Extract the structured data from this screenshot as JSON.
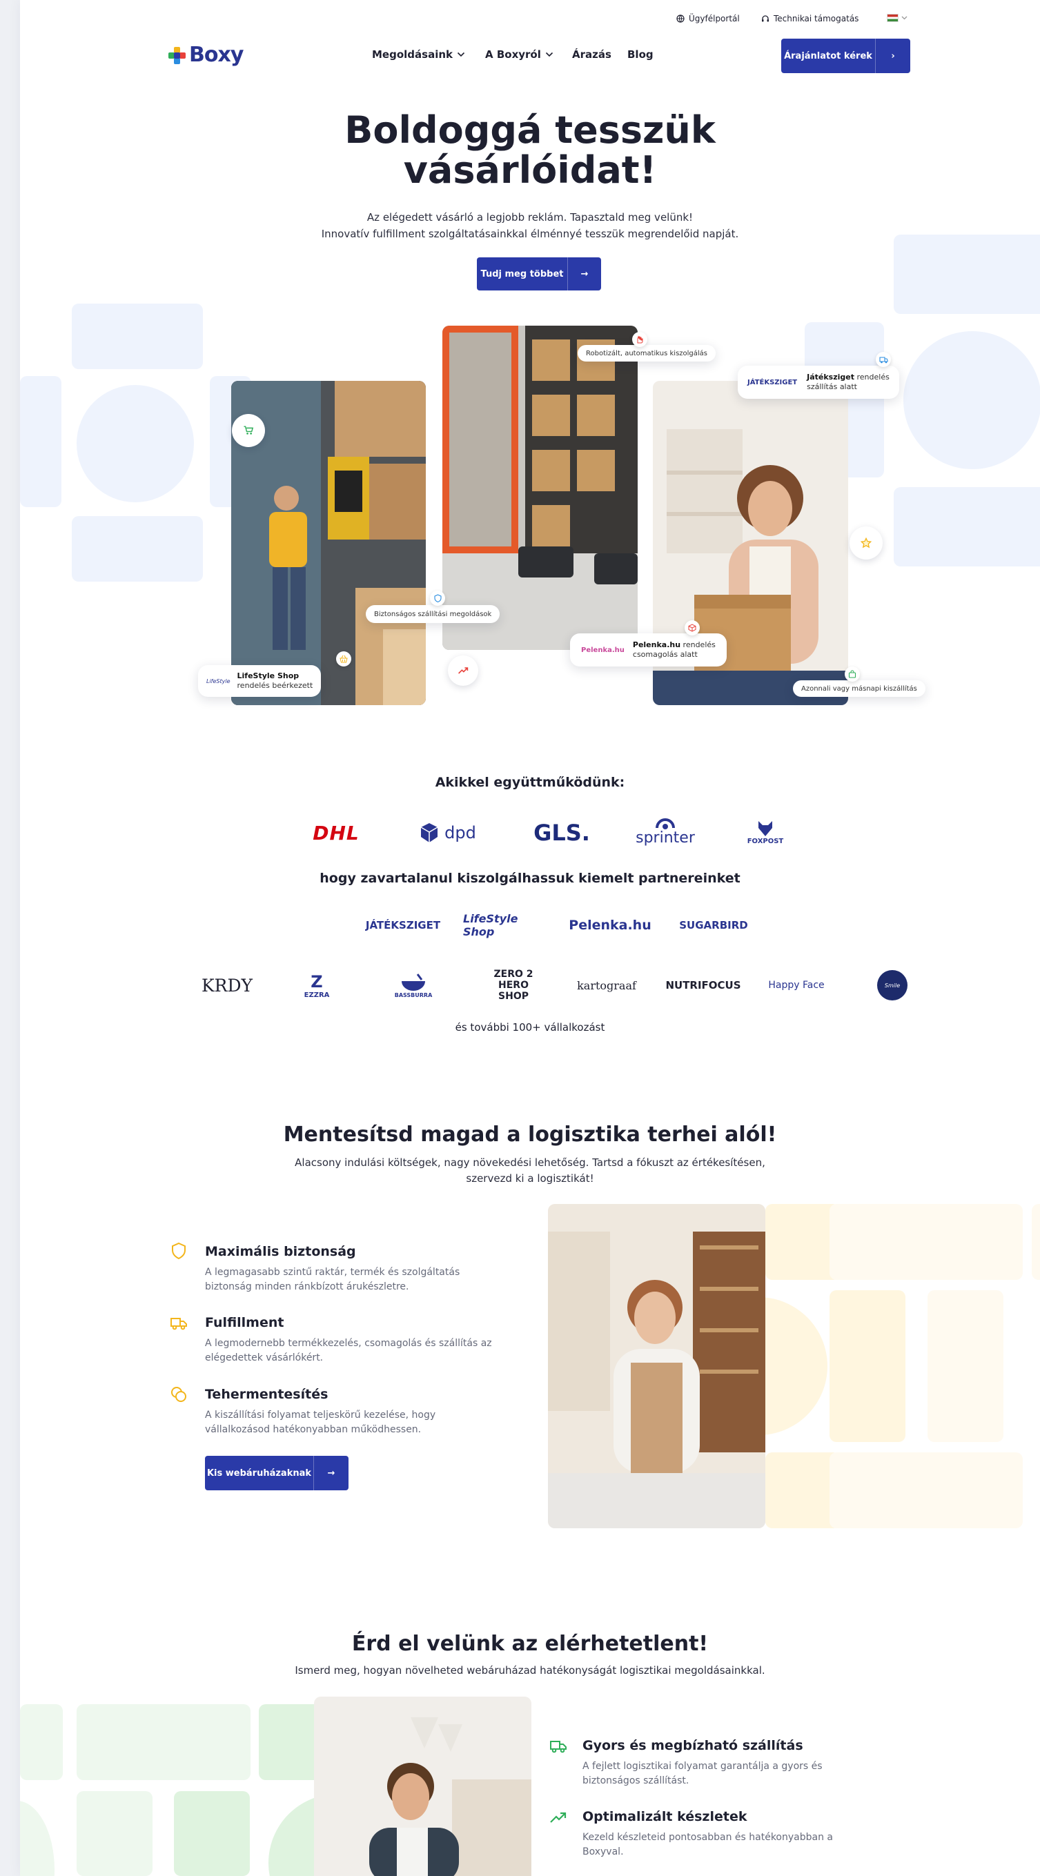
{
  "colors": {
    "navy": "#2a3aa8",
    "brand_text": "#2a3590",
    "yellow": "#f3b51b",
    "green": "#2fae59",
    "pale_blue": "#eef3fd",
    "pale_yellow": "#fff6df",
    "pale_green": "#eef8ee"
  },
  "topbar": {
    "customer_portal": "Ügyfélportál",
    "tech_support": "Technikai támogatás"
  },
  "header": {
    "logo": "Boxy",
    "nav": [
      "Megoldásaink",
      "A Boxyról",
      "Árazás",
      "Blog"
    ],
    "cta": "Árajánlatot kérek",
    "cta_arrow": "›"
  },
  "hero": {
    "title_line1": "Boldoggá tesszük",
    "title_line2": "vásárlóidat!",
    "sub_line1": "Az elégedett vásárló a legjobb reklám. Tapasztald meg velünk!",
    "sub_line2": "Innovatív fulfillment szolgáltatásainkkal élménnyé tesszük megrendelőid napját.",
    "cta": "Tudj meg többet",
    "cta_arrow": "→",
    "chips": {
      "robots": "Robotizált, automatikus kiszolgálás",
      "jateksziget_bold": "Játéksziget",
      "jateksziget_rest1": " rendelés",
      "jateksziget_rest2": "szállítás alatt",
      "safety": "Biztonságos szállítási megoldások",
      "pelenka_bold": "Pelenka.hu",
      "pelenka_rest1": " rendelés",
      "pelenka_rest2": "csomagolás alatt",
      "lifestyle_bold": "LifeStyle Shop",
      "lifestyle_rest": "rendelés beérkezett",
      "sameday": "Azonnali vagy másnapi kiszállítás"
    },
    "icons": [
      "cart-icon",
      "hand-icon",
      "truck-icon",
      "star-icon",
      "shield-icon",
      "box-icon",
      "trend-icon",
      "basket-icon",
      "bag-icon"
    ]
  },
  "partners": {
    "carriers_title": "Akikkel együttműködünk:",
    "carriers": [
      "DHL",
      "dpd",
      "GLS.",
      "sprinter",
      "FOXPOST"
    ],
    "featured_title": "hogy zavartalanul kiszolgálhassuk kiemelt partnereinket",
    "featured": [
      "JÁTÉKSZIGET",
      "LifeStyle Shop",
      "Pelenka.hu",
      "SUGARBIRD"
    ],
    "others": [
      "KRDY",
      "EZZRA",
      "BASSBURRA",
      "ZERO 2 HERO SHOP",
      "kartograaf",
      "NUTRIFOCUS",
      "Happy Face",
      "Smile"
    ],
    "more": "és további 100+ vállalkozást"
  },
  "relief": {
    "title": "Mentesítsd magad a logisztika terhei alól!",
    "sub_line1": "Alacsony indulási költségek,  nagy növekedési lehetőség. Tartsd a fókuszt az értékesítésen,",
    "sub_line2": "szervezd ki a logisztikát!",
    "features": [
      {
        "title": "Maximális biztonság",
        "desc1": "A legmagasabb szintű raktár, termék és szolgáltatás",
        "desc2": "biztonság  minden ránkbízott árukészletre."
      },
      {
        "title": "Fulfillment",
        "desc1": "A legmodernebb termékkezelés, csomagolás és szállítás az",
        "desc2": "elégedettek vásárlókért."
      },
      {
        "title": "Tehermentesítés",
        "desc1": "A kiszállítási folyamat teljeskörű kezelése, hogy",
        "desc2": "vállalkozásod hatékonyabban működhessen."
      }
    ],
    "cta": "Kis webáruházaknak",
    "cta_arrow": "→"
  },
  "reach": {
    "title": "Érd el velünk az elérhetetlent!",
    "sub": "Ismerd meg, hogyan növelheted webáruházad hatékonyságát logisztikai megoldásainkkal.",
    "features": [
      {
        "title": "Gyors és megbízható szállítás",
        "desc1": "A fejlett logisztikai folyamat garantálja a gyors és",
        "desc2": "biztonságos szállítást."
      },
      {
        "title": "Optimalizált készletek",
        "desc1": "Kezeld készleteid pontosabban és hatékonyabban a",
        "desc2": "Boxyval."
      }
    ]
  }
}
